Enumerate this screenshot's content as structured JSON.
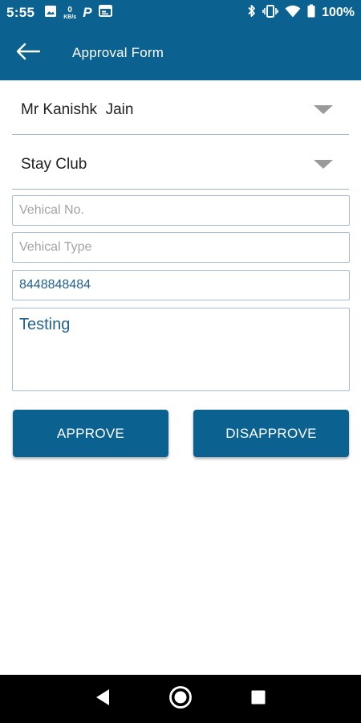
{
  "status_bar": {
    "time": "5:55",
    "network_speed_value": "0",
    "network_speed_unit": "KB/s",
    "parking_letter": "P",
    "battery_percent": "100%",
    "icons": [
      "image-icon",
      "network-speed-icon",
      "parking-icon",
      "calendar-icon",
      "bluetooth-icon",
      "vibrate-icon",
      "wifi-icon",
      "battery-icon"
    ]
  },
  "app_bar": {
    "title": "Approval Form",
    "back_icon": "arrow-left-icon"
  },
  "form": {
    "person_dropdown": {
      "value": "Mr Kanishk  Jain"
    },
    "location_dropdown": {
      "value": "Stay Club"
    },
    "vehicle_number": {
      "placeholder": "Vehical No.",
      "value": ""
    },
    "vehicle_type": {
      "placeholder": "Vehical Type",
      "value": ""
    },
    "phone": {
      "value": "8448848484"
    },
    "remarks": {
      "value": "Testing"
    }
  },
  "actions": {
    "approve_label": "APPROVE",
    "disapprove_label": "DISAPPROVE"
  },
  "nav_bar": {
    "icons": [
      "back-triangle-icon",
      "home-circle-icon",
      "recents-square-icon"
    ]
  },
  "colors": {
    "primary": "#0b6190",
    "input_border": "#a7bdcf",
    "input_text": "#23618c",
    "placeholder": "#a3a3a3"
  }
}
